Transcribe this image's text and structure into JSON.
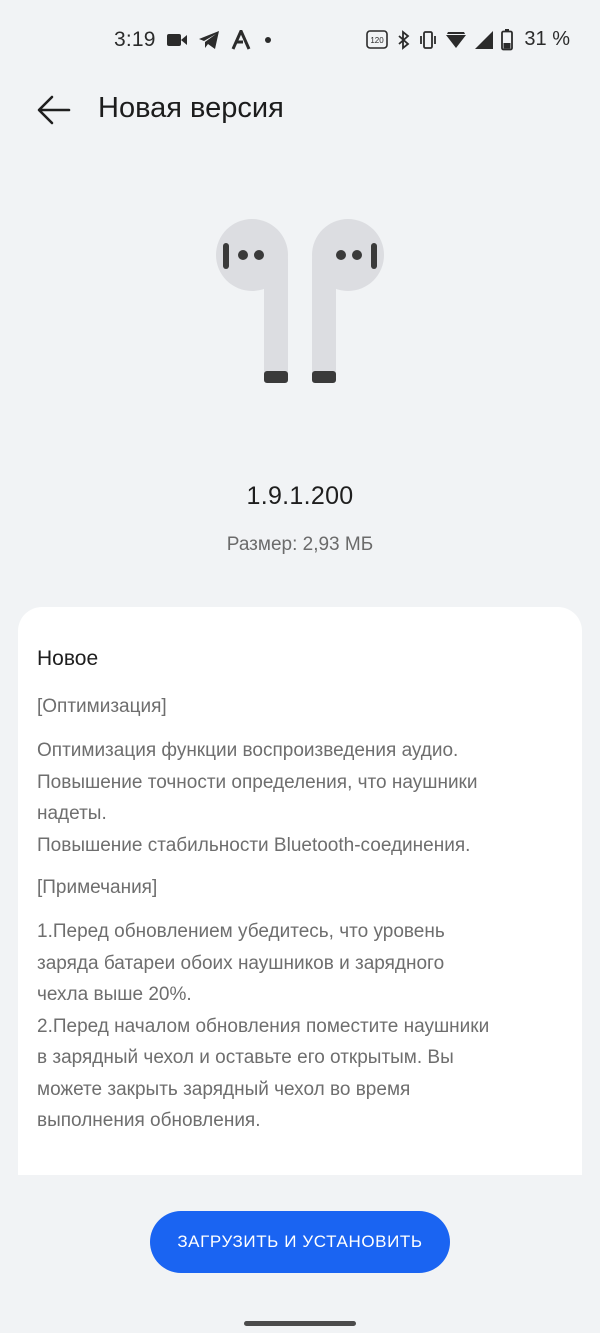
{
  "status_bar": {
    "time": "3:19",
    "battery_percent": "31 %",
    "left_icons": [
      "video-camera-icon",
      "telegram-icon",
      "app-a-icon",
      "dot-icon"
    ],
    "right_icons": [
      "refresh-rate-120-icon",
      "bluetooth-icon",
      "vibrate-icon",
      "wifi-icon",
      "signal-icon",
      "battery-icon"
    ],
    "refresh_rate_label": "120"
  },
  "header": {
    "back_icon": "arrow-left-icon",
    "title": "Новая версия"
  },
  "update": {
    "version": "1.9.1.200",
    "size": "Размер: 2,93 МБ",
    "illustration": "earbuds-icon"
  },
  "notes": {
    "heading": "Новое",
    "sections": [
      {
        "title": "[Оптимизация]",
        "items": [
          [
            "Оптимизация функции воспроизведения аудио."
          ],
          [
            "Повышение точности определения, что наушники",
            "надеты."
          ],
          [
            "Повышение стабильности Bluetooth-соединения."
          ]
        ]
      },
      {
        "title": "[Примечания]",
        "items": [
          [
            "1.Перед обновлением убедитесь, что уровень",
            "заряда батареи обоих наушников и зарядного",
            "чехла выше 20%."
          ],
          [
            "2.Перед началом обновления поместите наушники",
            "в зарядный чехол и оставьте его открытым. Вы",
            "можете закрыть зарядный чехол во время",
            "выполнения обновления."
          ]
        ]
      }
    ]
  },
  "actions": {
    "download_install_label": "ЗАГРУЗИТЬ И УСТАНОВИТЬ"
  },
  "colors": {
    "background": "#f1f3f5",
    "card": "#ffffff",
    "accent": "#1a64f2",
    "secondary_text": "#6e6e6e"
  }
}
